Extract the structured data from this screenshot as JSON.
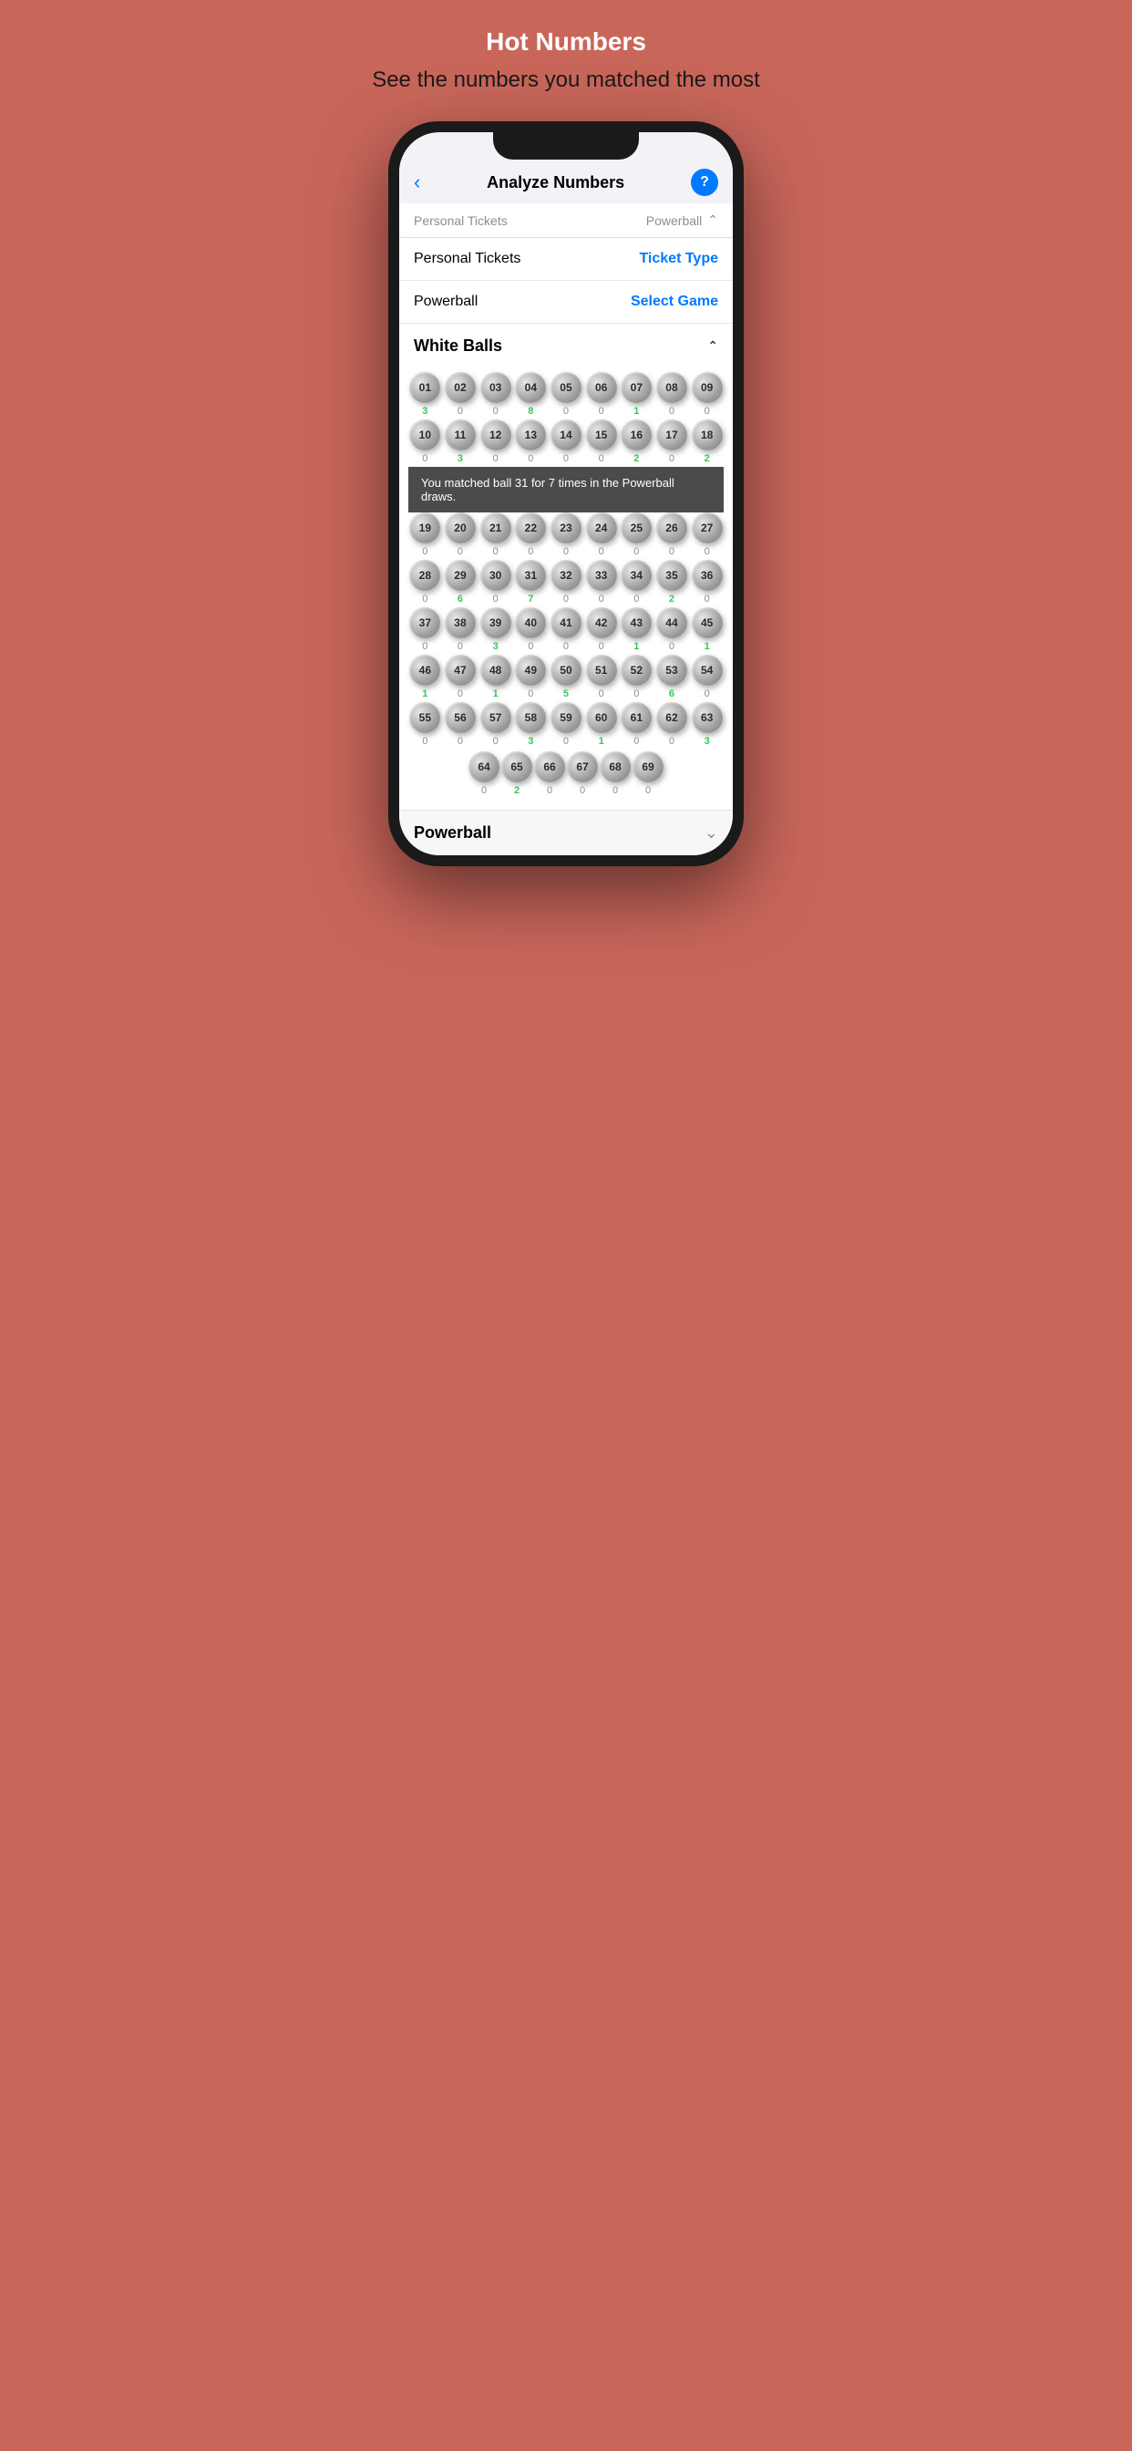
{
  "page": {
    "title": "Hot Numbers",
    "subtitle": "See the numbers you matched the most"
  },
  "nav": {
    "back_label": "‹",
    "title": "Analyze Numbers",
    "help_label": "?"
  },
  "dropdown": {
    "label": "Personal Tickets",
    "game": "Powerball",
    "chevron": "up"
  },
  "settings": {
    "ticket_type_label": "Personal Tickets",
    "ticket_type_action": "Ticket Type",
    "game_label": "Powerball",
    "game_action": "Select Game"
  },
  "white_balls_section": {
    "title": "White Balls"
  },
  "tooltip": {
    "text": "You matched ball 31 for 7 times in the Powerball draws."
  },
  "balls": [
    {
      "num": "01",
      "count": "3",
      "hot": true
    },
    {
      "num": "02",
      "count": "0",
      "hot": false
    },
    {
      "num": "03",
      "count": "0",
      "hot": false
    },
    {
      "num": "04",
      "count": "8",
      "hot": true
    },
    {
      "num": "05",
      "count": "0",
      "hot": false
    },
    {
      "num": "06",
      "count": "0",
      "hot": false
    },
    {
      "num": "07",
      "count": "1",
      "hot": true
    },
    {
      "num": "08",
      "count": "0",
      "hot": false
    },
    {
      "num": "09",
      "count": "0",
      "hot": false
    },
    {
      "num": "10",
      "count": "0",
      "hot": false
    },
    {
      "num": "11",
      "count": "3",
      "hot": true
    },
    {
      "num": "12",
      "count": "0",
      "hot": false
    },
    {
      "num": "13",
      "count": "0",
      "hot": false
    },
    {
      "num": "14",
      "count": "0",
      "hot": false
    },
    {
      "num": "15",
      "count": "0",
      "hot": false
    },
    {
      "num": "16",
      "count": "2",
      "hot": true
    },
    {
      "num": "17",
      "count": "0",
      "hot": false
    },
    {
      "num": "18",
      "count": "2",
      "hot": true
    },
    {
      "num": "19",
      "count": "0",
      "hot": false
    },
    {
      "num": "20",
      "count": "0",
      "hot": false
    },
    {
      "num": "21",
      "count": "0",
      "hot": false
    },
    {
      "num": "22",
      "count": "0",
      "hot": false
    },
    {
      "num": "23",
      "count": "0",
      "hot": false
    },
    {
      "num": "24",
      "count": "0",
      "hot": false
    },
    {
      "num": "25",
      "count": "0",
      "hot": false
    },
    {
      "num": "26",
      "count": "0",
      "hot": false
    },
    {
      "num": "27",
      "count": "0",
      "hot": false
    },
    {
      "num": "28",
      "count": "0",
      "hot": false
    },
    {
      "num": "29",
      "count": "6",
      "hot": true
    },
    {
      "num": "30",
      "count": "0",
      "hot": false
    },
    {
      "num": "31",
      "count": "7",
      "hot": true
    },
    {
      "num": "32",
      "count": "0",
      "hot": false
    },
    {
      "num": "33",
      "count": "0",
      "hot": false
    },
    {
      "num": "34",
      "count": "0",
      "hot": false
    },
    {
      "num": "35",
      "count": "2",
      "hot": true
    },
    {
      "num": "36",
      "count": "0",
      "hot": false
    },
    {
      "num": "37",
      "count": "0",
      "hot": false
    },
    {
      "num": "38",
      "count": "0",
      "hot": false
    },
    {
      "num": "39",
      "count": "3",
      "hot": true
    },
    {
      "num": "40",
      "count": "0",
      "hot": false
    },
    {
      "num": "41",
      "count": "0",
      "hot": false
    },
    {
      "num": "42",
      "count": "0",
      "hot": false
    },
    {
      "num": "43",
      "count": "1",
      "hot": true
    },
    {
      "num": "44",
      "count": "0",
      "hot": false
    },
    {
      "num": "45",
      "count": "1",
      "hot": true
    },
    {
      "num": "46",
      "count": "1",
      "hot": true
    },
    {
      "num": "47",
      "count": "0",
      "hot": false
    },
    {
      "num": "48",
      "count": "1",
      "hot": true
    },
    {
      "num": "49",
      "count": "0",
      "hot": false
    },
    {
      "num": "50",
      "count": "5",
      "hot": true
    },
    {
      "num": "51",
      "count": "0",
      "hot": false
    },
    {
      "num": "52",
      "count": "0",
      "hot": false
    },
    {
      "num": "53",
      "count": "6",
      "hot": true
    },
    {
      "num": "54",
      "count": "0",
      "hot": false
    },
    {
      "num": "55",
      "count": "0",
      "hot": false
    },
    {
      "num": "56",
      "count": "0",
      "hot": false
    },
    {
      "num": "57",
      "count": "0",
      "hot": false
    },
    {
      "num": "58",
      "count": "3",
      "hot": true
    },
    {
      "num": "59",
      "count": "0",
      "hot": false
    },
    {
      "num": "60",
      "count": "1",
      "hot": true
    },
    {
      "num": "61",
      "count": "0",
      "hot": false
    },
    {
      "num": "62",
      "count": "0",
      "hot": false
    },
    {
      "num": "63",
      "count": "3",
      "hot": true
    },
    {
      "num": "64",
      "count": "0",
      "hot": false
    },
    {
      "num": "65",
      "count": "2",
      "hot": true
    },
    {
      "num": "66",
      "count": "0",
      "hot": false
    },
    {
      "num": "67",
      "count": "0",
      "hot": false
    },
    {
      "num": "68",
      "count": "0",
      "hot": false
    },
    {
      "num": "69",
      "count": "0",
      "hot": false
    }
  ],
  "powerball_section": {
    "label": "Powerball"
  }
}
